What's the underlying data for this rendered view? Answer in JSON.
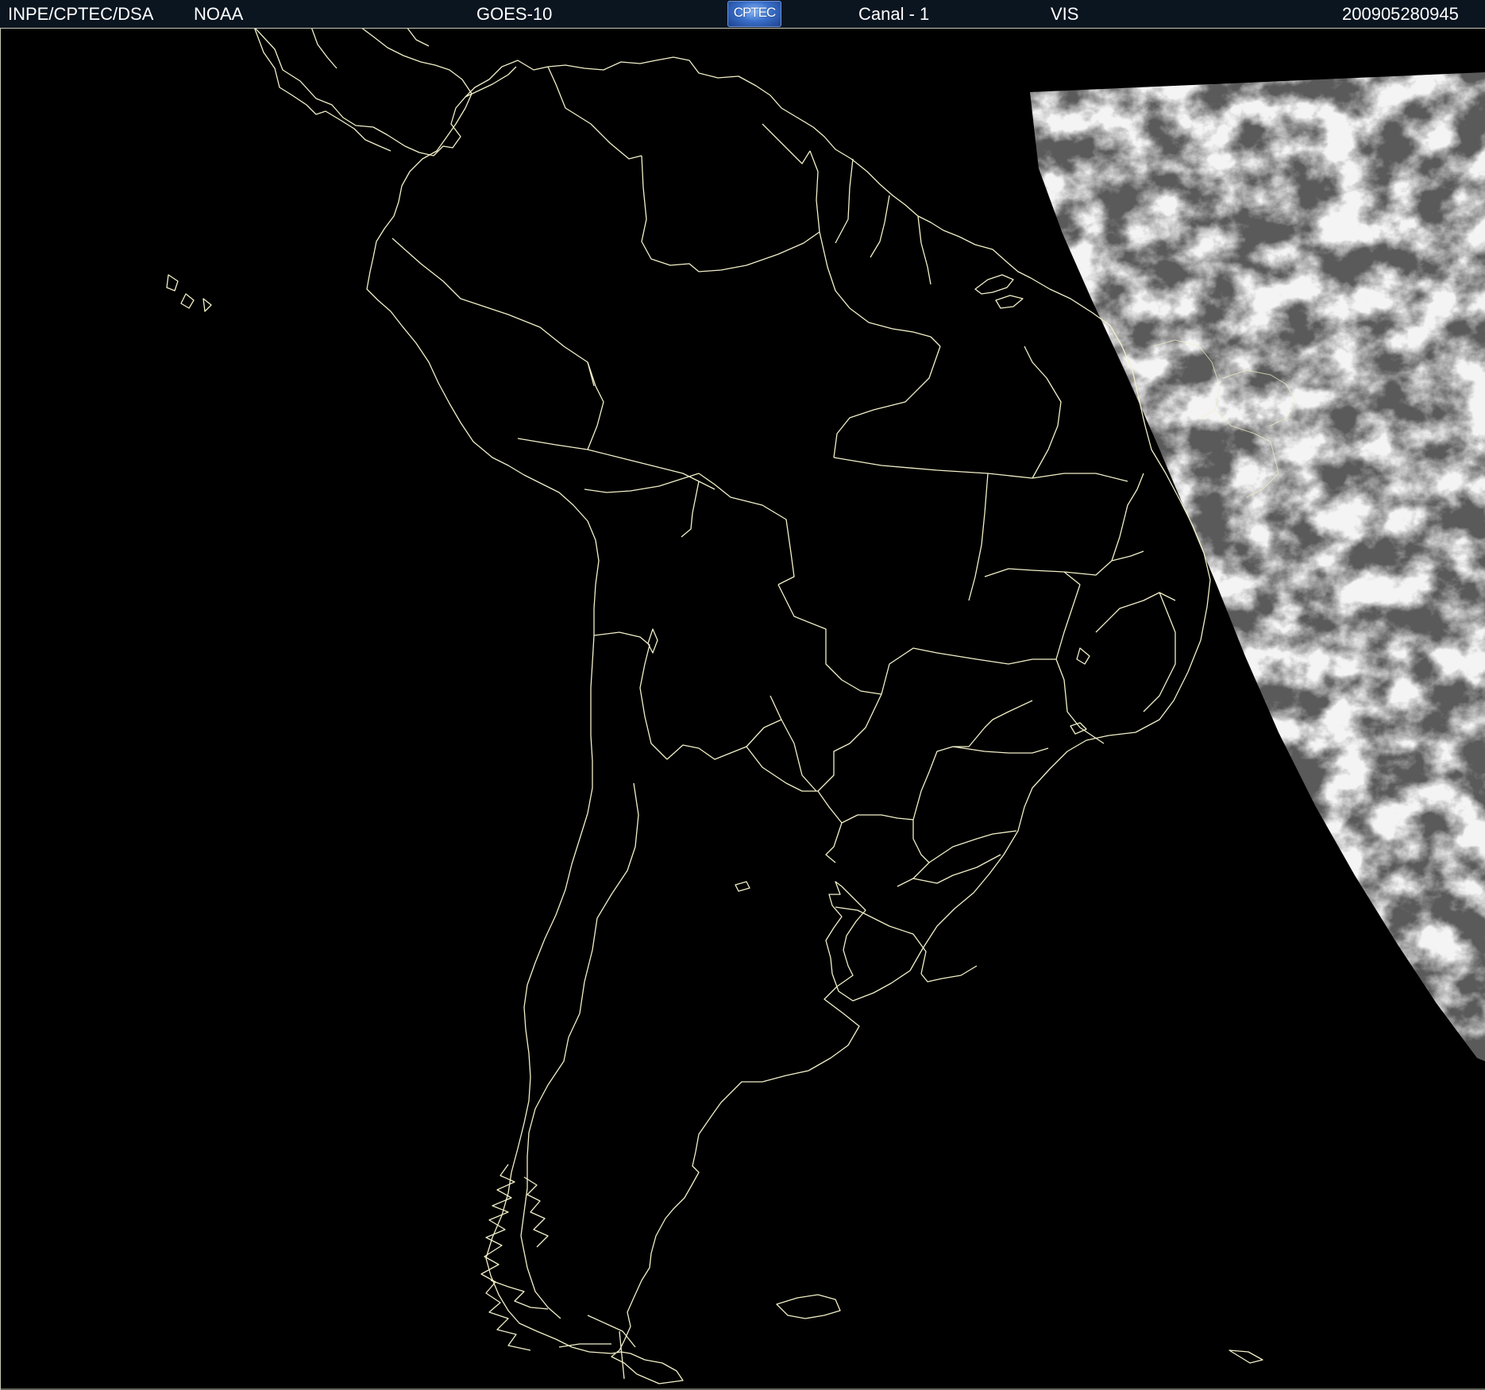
{
  "header": {
    "source": "INPE/CPTEC/DSA",
    "agency": "NOAA",
    "satellite": "GOES-10",
    "logo": "CPTEC",
    "channel": "Canal - 1",
    "band": "VIS",
    "timestamp": "200905280945"
  },
  "map": {
    "region": "South America",
    "background_color": "#000000",
    "boundary_color": "#f2f0c8",
    "cloud_color": "#d9d9d9"
  }
}
